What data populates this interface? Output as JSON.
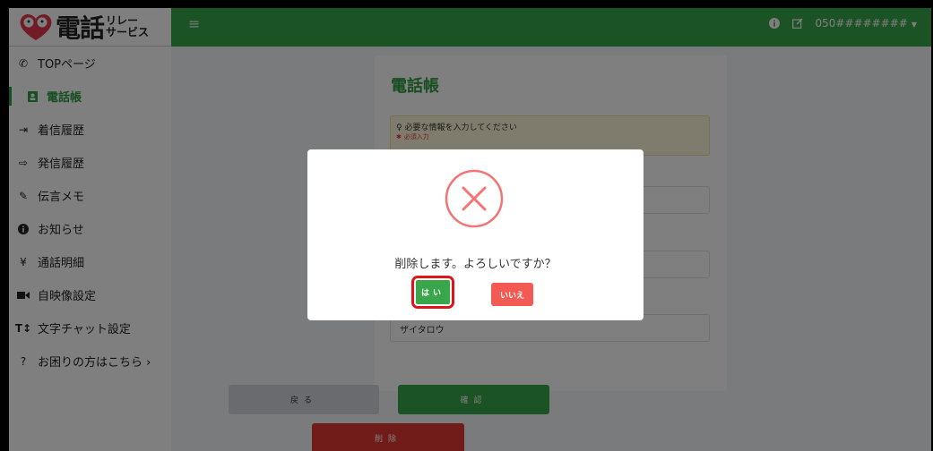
{
  "header": {
    "logo_text": "電話",
    "logo_sub_top": "リレー",
    "logo_sub_bottom": "サービス",
    "phone_number": "050########",
    "colors": {
      "brand": "#39a64b",
      "danger": "#e53935"
    }
  },
  "sidebar": {
    "items": [
      {
        "label": "TOPページ",
        "icon": "phone-icon"
      },
      {
        "label": "電話帳",
        "icon": "address-book-icon",
        "active": true
      },
      {
        "label": "着信履歴",
        "icon": "sign-in-icon"
      },
      {
        "label": "発信履歴",
        "icon": "sign-out-icon"
      },
      {
        "label": "伝言メモ",
        "icon": "edit-icon"
      },
      {
        "label": "お知らせ",
        "icon": "info-icon"
      },
      {
        "label": "通話明細",
        "icon": "yen-icon"
      },
      {
        "label": "自映像設定",
        "icon": "video-icon"
      },
      {
        "label": "文字チャット設定",
        "icon": "text-height-icon"
      },
      {
        "label": "お困りの方はこちら ›",
        "icon": "question-circle-icon"
      }
    ]
  },
  "main": {
    "title": "電話帳",
    "notice_text": "必要な情報を入力してください",
    "notice_required": "必須入力",
    "field_kana_value": "ザイタロウ",
    "back_label": "戻る",
    "confirm_label": "確認",
    "delete_label": "削除"
  },
  "dialog": {
    "message": "削除します。よろしいですか？",
    "yes_label": "はい",
    "no_label": "いいえ"
  }
}
